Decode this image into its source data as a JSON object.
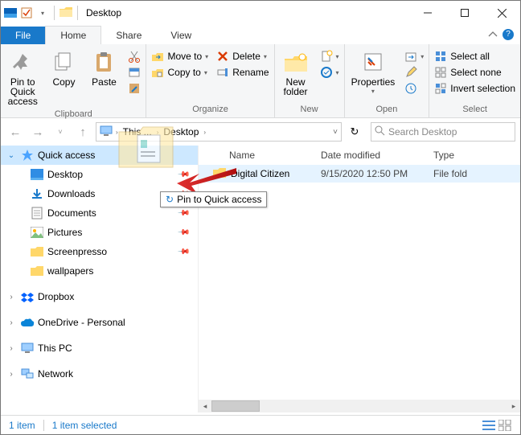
{
  "window": {
    "title": "Desktop"
  },
  "tabs": {
    "file": "File",
    "home": "Home",
    "share": "Share",
    "view": "View"
  },
  "ribbon": {
    "clipboard": {
      "label": "Clipboard",
      "pin": "Pin to Quick\naccess",
      "copy": "Copy",
      "paste": "Paste"
    },
    "organize": {
      "label": "Organize",
      "move_to": "Move to",
      "copy_to": "Copy to",
      "delete": "Delete",
      "rename": "Rename"
    },
    "new": {
      "label": "New",
      "new_folder": "New\nfolder"
    },
    "open": {
      "label": "Open",
      "properties": "Properties"
    },
    "select": {
      "label": "Select",
      "all": "Select all",
      "none": "Select none",
      "invert": "Invert selection"
    }
  },
  "breadcrumb": {
    "parts": [
      "This ...",
      "Desktop"
    ],
    "refresh_down": "v"
  },
  "search": {
    "placeholder": "Search Desktop"
  },
  "sidebar": {
    "quick_access": "Quick access",
    "items": [
      {
        "label": "Desktop"
      },
      {
        "label": "Downloads"
      },
      {
        "label": "Documents"
      },
      {
        "label": "Pictures"
      },
      {
        "label": "Screenpresso"
      },
      {
        "label": "wallpapers"
      }
    ],
    "dropbox": "Dropbox",
    "onedrive": "OneDrive - Personal",
    "this_pc": "This PC",
    "network": "Network"
  },
  "columns": {
    "name": "Name",
    "date": "Date modified",
    "type": "Type"
  },
  "files": [
    {
      "name": "Digital Citizen",
      "date": "9/15/2020 12:50 PM",
      "type": "File fold"
    }
  ],
  "tooltip": "Pin to Quick access",
  "status": {
    "count": "1 item",
    "selected": "1 item selected"
  }
}
